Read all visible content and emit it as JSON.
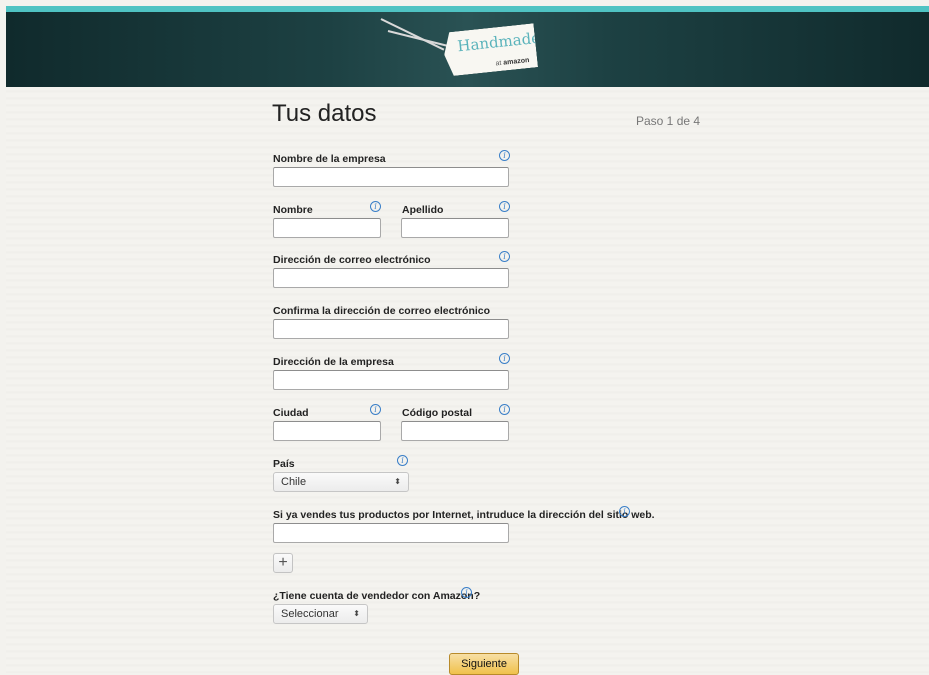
{
  "header": {
    "logo_title": "Handmade",
    "logo_sub_at": "at",
    "logo_sub_brand": "amazon",
    "accent_color": "#4fc3c3"
  },
  "page": {
    "title": "Tus datos",
    "step": "Paso 1 de 4"
  },
  "form": {
    "company_name_label": "Nombre de la empresa",
    "first_name_label": "Nombre",
    "last_name_label": "Apellido",
    "email_label": "Dirección de correo electrónico",
    "email_confirm_label": "Confirma la dirección de correo electrónico",
    "address_label": "Dirección de la empresa",
    "city_label": "Ciudad",
    "postal_label": "Código postal",
    "country_label": "País",
    "country_value": "Chile",
    "website_label": "Si ya vendes tus productos por Internet, intruduce la dirección del sitio web.",
    "add_symbol": "+",
    "seller_label": "¿Tiene cuenta de vendedor con Amazon?",
    "seller_value": "Seleccionar",
    "info_glyph": "i",
    "select_arrow": "⬍",
    "next_button": "Siguiente"
  }
}
